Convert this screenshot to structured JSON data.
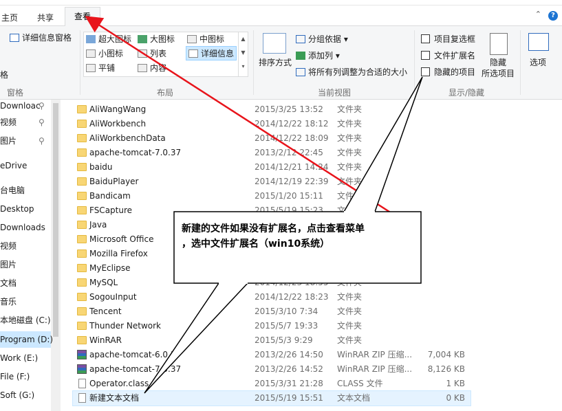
{
  "tabs": {
    "home": "主页",
    "share": "共享",
    "view": "查看"
  },
  "ribbon": {
    "panes_label": "窗格",
    "details_pane": "详细信息窗格",
    "layout_label": "布局",
    "layout_items": {
      "extra_large": "超大图标",
      "large": "大图标",
      "medium": "中图标",
      "small": "小图标",
      "list": "列表",
      "details": "详细信息",
      "tiles": "平铺",
      "content": "内容"
    },
    "current_view_label": "当前视图",
    "sort_by": "排序方式",
    "group_by": "分组依据",
    "add_column": "添加列",
    "fit_columns": "将所有列调整为合适的大小",
    "show_hide_label": "显示/隐藏",
    "item_checkboxes": "项目复选框",
    "file_extensions": "文件扩展名",
    "hidden_items": "隐藏的项目",
    "hide_selected_1": "隐藏",
    "hide_selected_2": "所选项目",
    "options": "选项",
    "partial_left": "格"
  },
  "nav": [
    {
      "label": "Downloac",
      "pinned": true
    },
    {
      "label": "视频",
      "pinned": true
    },
    {
      "label": "图片",
      "pinned": true
    },
    {
      "label": "eDrive",
      "pinned": false
    },
    {
      "label": "台电脑",
      "pinned": false
    },
    {
      "label": "Desktop",
      "pinned": false
    },
    {
      "label": "Downloads",
      "pinned": false
    },
    {
      "label": "视频",
      "pinned": false
    },
    {
      "label": "图片",
      "pinned": false
    },
    {
      "label": "文档",
      "pinned": false
    },
    {
      "label": "音乐",
      "pinned": false
    },
    {
      "label": "本地磁盘 (C:)",
      "pinned": false
    },
    {
      "label": "Program (D:)",
      "pinned": false
    },
    {
      "label": "Work (E:)",
      "pinned": false
    },
    {
      "label": "File (F:)",
      "pinned": false
    },
    {
      "label": "Soft (G:)",
      "pinned": false
    }
  ],
  "files": [
    {
      "name": "AliWangWang",
      "date": "2015/3/25 13:52",
      "type": "文件夹",
      "size": "",
      "kind": "folder"
    },
    {
      "name": "AliWorkbench",
      "date": "2014/12/22 18:12",
      "type": "文件夹",
      "size": "",
      "kind": "folder"
    },
    {
      "name": "AliWorkbenchData",
      "date": "2014/12/22 18:09",
      "type": "文件夹",
      "size": "",
      "kind": "folder"
    },
    {
      "name": "apache-tomcat-7.0.37",
      "date": "2013/2/12 22:45",
      "type": "文件夹",
      "size": "",
      "kind": "folder"
    },
    {
      "name": "baidu",
      "date": "2014/12/21 14:24",
      "type": "文件夹",
      "size": "",
      "kind": "folder"
    },
    {
      "name": "BaiduPlayer",
      "date": "2014/12/19 22:39",
      "type": "文件夹",
      "size": "",
      "kind": "folder"
    },
    {
      "name": "Bandicam",
      "date": "2015/1/20 15:11",
      "type": "文件夹",
      "size": "",
      "kind": "folder"
    },
    {
      "name": "FSCapture",
      "date": "2015/5/19 15:23",
      "type": "文件夹",
      "size": "",
      "kind": "folder"
    },
    {
      "name": "Java",
      "date": "",
      "type": "",
      "size": "",
      "kind": "folder"
    },
    {
      "name": "Microsoft Office",
      "date": "",
      "type": "",
      "size": "",
      "kind": "folder"
    },
    {
      "name": "Mozilla Firefox",
      "date": "",
      "type": "",
      "size": "",
      "kind": "folder"
    },
    {
      "name": "MyEclipse",
      "date": "",
      "type": "",
      "size": "",
      "kind": "folder"
    },
    {
      "name": "MySQL",
      "date": "2014/12/23 18:55",
      "type": "文件夹",
      "size": "",
      "kind": "folder"
    },
    {
      "name": "SogouInput",
      "date": "2014/12/22 18:23",
      "type": "文件夹",
      "size": "",
      "kind": "folder"
    },
    {
      "name": "Tencent",
      "date": "2015/3/10 7:34",
      "type": "文件夹",
      "size": "",
      "kind": "folder"
    },
    {
      "name": "Thunder Network",
      "date": "2015/5/7 19:33",
      "type": "文件夹",
      "size": "",
      "kind": "folder"
    },
    {
      "name": "WinRAR",
      "date": "2015/5/3 9:29",
      "type": "文件夹",
      "size": "",
      "kind": "folder"
    },
    {
      "name": "apache-tomcat-6.0.3",
      "date": "2013/2/26 14:50",
      "type": "WinRAR ZIP 压缩...",
      "size": "7,004 KB",
      "kind": "rar"
    },
    {
      "name": "apache-tomcat-7.0.37",
      "date": "2013/2/26 14:52",
      "type": "WinRAR ZIP 压缩...",
      "size": "8,126 KB",
      "kind": "rar"
    },
    {
      "name": "Operator.class",
      "date": "2015/3/31 21:28",
      "type": "CLASS 文件",
      "size": "1 KB",
      "kind": "doc"
    },
    {
      "name": "新建文本文档",
      "date": "2015/5/19 15:51",
      "type": "文本文档",
      "size": "0 KB",
      "kind": "doc"
    }
  ],
  "callout": {
    "line1": "新建的文件如果没有扩展名，点击查看菜单",
    "line2": "，选中文件扩展名（win10系统）"
  },
  "colors": {
    "arrow": "#e8141b",
    "folder": "#f8d675",
    "selection": "#cce8ff"
  }
}
